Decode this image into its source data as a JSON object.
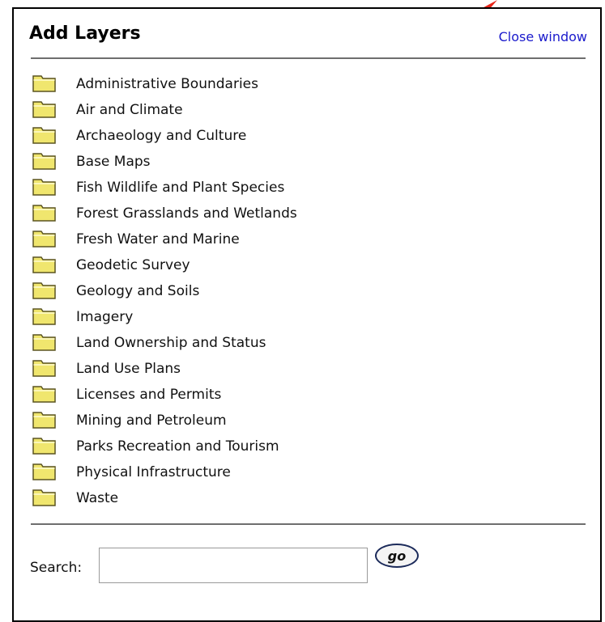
{
  "window": {
    "title": "Add Layers",
    "close_label": "Close window"
  },
  "layers": [
    {
      "label": "Administrative Boundaries",
      "icon": "folder-icon"
    },
    {
      "label": "Air and Climate",
      "icon": "folder-icon"
    },
    {
      "label": "Archaeology and Culture",
      "icon": "folder-icon"
    },
    {
      "label": "Base Maps",
      "icon": "folder-icon"
    },
    {
      "label": "Fish Wildlife and Plant Species",
      "icon": "folder-icon"
    },
    {
      "label": "Forest Grasslands and Wetlands",
      "icon": "folder-icon"
    },
    {
      "label": "Fresh Water and Marine",
      "icon": "folder-icon"
    },
    {
      "label": "Geodetic Survey",
      "icon": "folder-icon"
    },
    {
      "label": "Geology and Soils",
      "icon": "folder-icon"
    },
    {
      "label": "Imagery",
      "icon": "folder-icon"
    },
    {
      "label": "Land Ownership and Status",
      "icon": "folder-icon"
    },
    {
      "label": "Land Use Plans",
      "icon": "folder-icon"
    },
    {
      "label": "Licenses and Permits",
      "icon": "folder-icon"
    },
    {
      "label": "Mining and Petroleum",
      "icon": "folder-icon"
    },
    {
      "label": "Parks Recreation and Tourism",
      "icon": "folder-icon"
    },
    {
      "label": "Physical Infrastructure",
      "icon": "folder-icon"
    },
    {
      "label": "Waste",
      "icon": "folder-icon"
    }
  ],
  "search": {
    "label": "Search:",
    "value": "",
    "placeholder": "",
    "go_label": "go"
  },
  "colors": {
    "link": "#1a1acc",
    "folder_fill": "#f0e66e",
    "folder_stroke": "#5a5420",
    "arrow": "#e8261a"
  }
}
